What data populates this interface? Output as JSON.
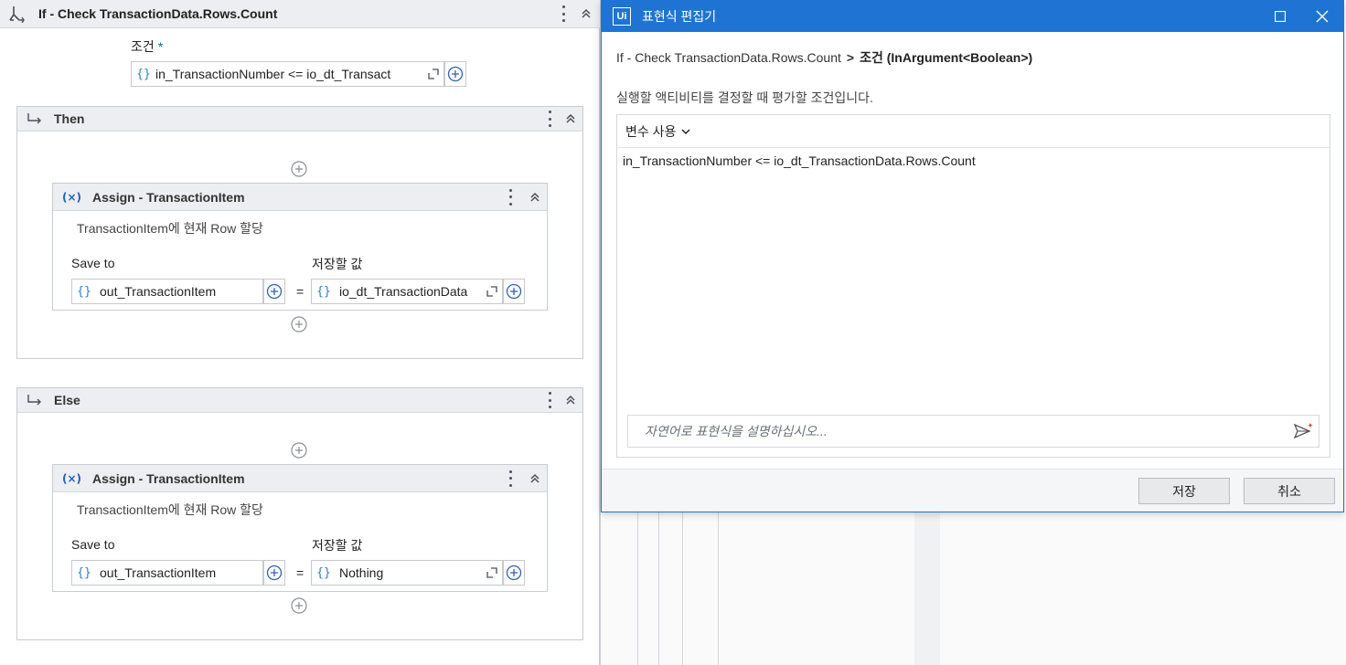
{
  "designer": {
    "if_title": "If - Check TransactionData.Rows.Count",
    "condition_label": "조건",
    "required_mark": "*",
    "condition_expr": "in_TransactionNumber <= io_dt_Transact",
    "then_label": "Then",
    "else_label": "Else",
    "then_assign": {
      "title": "Assign - TransactionItem",
      "description": "TransactionItem에 현재 Row 할당",
      "save_to_label": "Save to",
      "value_label": "저장할 값",
      "save_to_value": "out_TransactionItem",
      "equals": "=",
      "value_expr": "io_dt_TransactionData"
    },
    "else_assign": {
      "title": "Assign - TransactionItem",
      "description": "TransactionItem에 현재 Row 할당",
      "save_to_label": "Save to",
      "value_label": "저장할 값",
      "save_to_value": "out_TransactionItem",
      "equals": "=",
      "value_expr": "Nothing"
    },
    "brace_glyph": "{}"
  },
  "dialog": {
    "logo": "Ui",
    "title": "표현식 편집기",
    "breadcrumb_path": "If - Check TransactionData.Rows.Count",
    "breadcrumb_sep": ">",
    "breadcrumb_current": "조건 (InArgument<Boolean>)",
    "description": "실행할 액티비티를 결정할 때 평가할 조건입니다.",
    "variables_menu": "변수 사용",
    "expression": "in_TransactionNumber <= io_dt_TransactionData.Rows.Count",
    "nl_placeholder": "자연어로 표현식을 설명하십시오...",
    "save_button": "저장",
    "cancel_button": "취소"
  },
  "colors": {
    "accent": "#1f74d3",
    "brace": "#2f7dd1",
    "header_bg": "#eceef1"
  }
}
